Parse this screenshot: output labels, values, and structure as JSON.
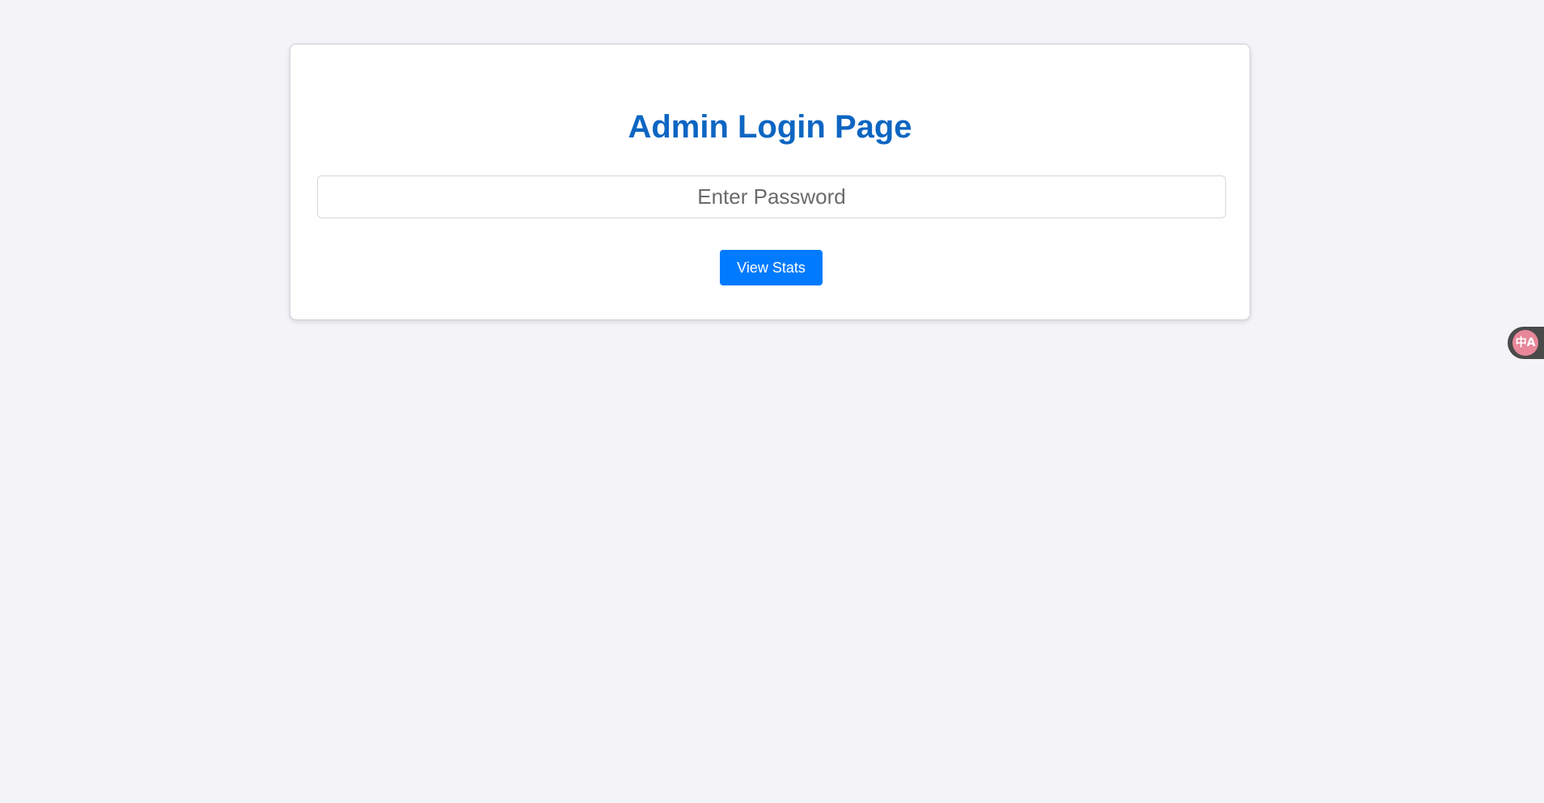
{
  "page": {
    "title": "Admin Login Page",
    "password_placeholder": "Enter Password",
    "submit_label": "View Stats"
  },
  "widget": {
    "icon_name": "translate-icon",
    "icon_glyph": "中A"
  },
  "colors": {
    "background": "#f4f4f8",
    "title": "#0d66c2",
    "button": "#007bff"
  }
}
